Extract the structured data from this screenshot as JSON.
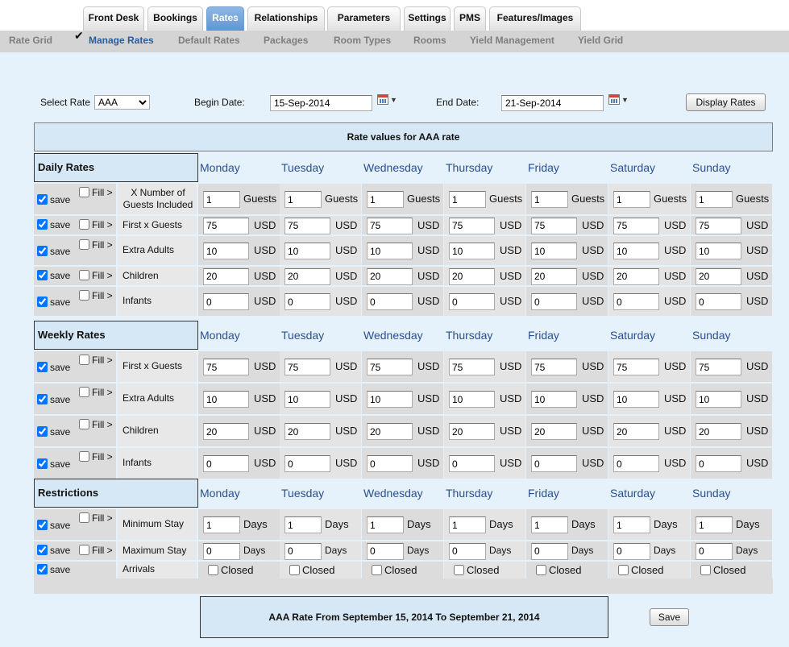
{
  "nav": {
    "tabs": [
      "Front Desk",
      "Bookings",
      "Rates",
      "Relationships",
      "Parameters",
      "Settings",
      "PMS",
      "Features/Images"
    ],
    "active_tab": "Rates",
    "subnav": [
      "Rate Grid",
      "Manage Rates",
      "Default Rates",
      "Packages",
      "Room Types",
      "Rooms",
      "Yield Management",
      "Yield Grid"
    ],
    "active_subnav": "Manage Rates"
  },
  "filters": {
    "select_rate_label": "Select Rate",
    "select_rate_value": "AAA",
    "begin_date_label": "Begin Date:",
    "begin_date": "15-Sep-2014",
    "end_date_label": "End Date:",
    "end_date": "21-Sep-2014",
    "display_button": "Display Rates"
  },
  "title": "Rate values for AAA rate",
  "days": [
    "Monday",
    "Tuesday",
    "Wednesday",
    "Thursday",
    "Friday",
    "Saturday",
    "Sunday"
  ],
  "labels": {
    "save": "save",
    "fill": "Fill >",
    "closed": "Closed"
  },
  "sections": [
    {
      "heading": "Daily Rates",
      "rows": [
        {
          "label": "X Number of Guests Included",
          "fill": true,
          "fill_wrap": true,
          "values": [
            "1",
            "1",
            "1",
            "1",
            "1",
            "1",
            "1"
          ],
          "unit": "Guests"
        },
        {
          "label": "First x Guests",
          "fill": true,
          "fill_wrap": false,
          "values": [
            "75",
            "75",
            "75",
            "75",
            "75",
            "75",
            "75"
          ],
          "unit": "USD"
        },
        {
          "label": "Extra Adults",
          "fill": true,
          "fill_wrap": true,
          "values": [
            "10",
            "10",
            "10",
            "10",
            "10",
            "10",
            "10"
          ],
          "unit": "USD"
        },
        {
          "label": "Children",
          "fill": true,
          "fill_wrap": false,
          "values": [
            "20",
            "20",
            "20",
            "20",
            "20",
            "20",
            "20"
          ],
          "unit": "USD"
        },
        {
          "label": "Infants",
          "fill": true,
          "fill_wrap": true,
          "values": [
            "0",
            "0",
            "0",
            "0",
            "0",
            "0",
            "0"
          ],
          "unit": "USD"
        }
      ]
    },
    {
      "heading": "Weekly Rates",
      "rows": [
        {
          "label": "First x Guests",
          "fill": true,
          "fill_wrap": true,
          "values": [
            "75",
            "75",
            "75",
            "75",
            "75",
            "75",
            "75"
          ],
          "unit": "USD"
        },
        {
          "label": "Extra Adults",
          "fill": true,
          "fill_wrap": true,
          "values": [
            "10",
            "10",
            "10",
            "10",
            "10",
            "10",
            "10"
          ],
          "unit": "USD"
        },
        {
          "label": "Children",
          "fill": true,
          "fill_wrap": true,
          "values": [
            "20",
            "20",
            "20",
            "20",
            "20",
            "20",
            "20"
          ],
          "unit": "USD"
        },
        {
          "label": "Infants",
          "fill": true,
          "fill_wrap": true,
          "values": [
            "0",
            "0",
            "0",
            "0",
            "0",
            "0",
            "0"
          ],
          "unit": "USD"
        }
      ]
    },
    {
      "heading": "Restrictions",
      "rows": [
        {
          "label": "Minimum Stay",
          "fill": true,
          "fill_wrap": true,
          "values": [
            "1",
            "1",
            "1",
            "1",
            "1",
            "1",
            "1"
          ],
          "unit": "Days"
        },
        {
          "label": "Maximum Stay",
          "fill": true,
          "fill_wrap": false,
          "values": [
            "0",
            "0",
            "0",
            "0",
            "0",
            "0",
            "0"
          ],
          "unit": "Days"
        },
        {
          "label": "Arrivals",
          "fill": false,
          "closed": true,
          "values": [],
          "unit": ""
        }
      ]
    }
  ],
  "summary": "AAA Rate From September 15, 2014 To September 21, 2014",
  "save_button": "Save",
  "colors": {
    "active_tab": "#6f9fd0",
    "panel_bg": "#e6f2fb",
    "header_box": "#d6e8f5",
    "day_text": "#2a4f8f"
  }
}
